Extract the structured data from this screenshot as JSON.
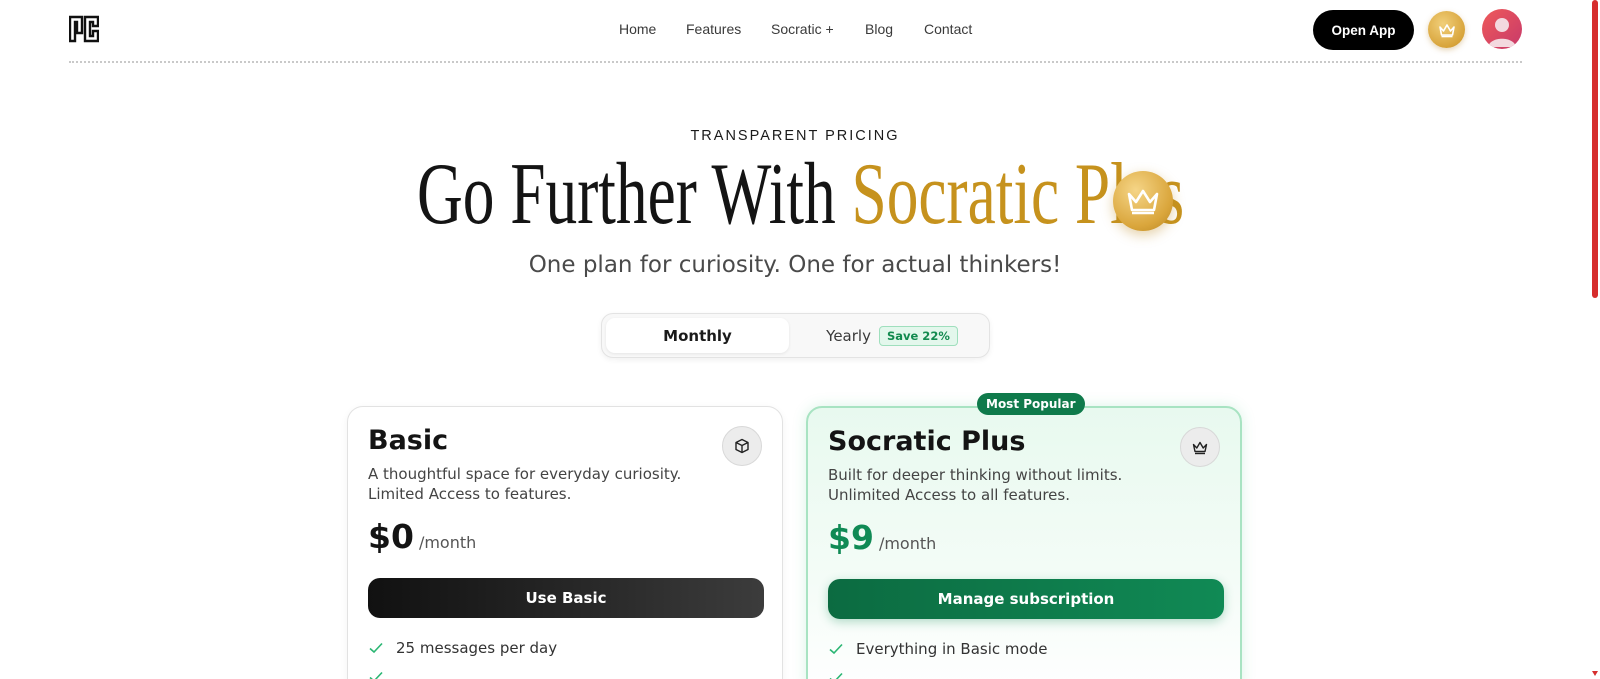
{
  "nav": {
    "links": [
      "Home",
      "Features",
      "Socratic +",
      "Blog",
      "Contact"
    ],
    "open_app": "Open App",
    "icons": [
      "logo-icon",
      "crown-icon",
      "avatar"
    ]
  },
  "hero": {
    "eyebrow": "TRANSPARENT PRICING",
    "headline_dark": "Go Further With",
    "headline_gold": "Socratic Plus",
    "subline": "One plan for curiosity. One for actual thinkers!"
  },
  "billing_toggle": {
    "monthly": "Monthly",
    "yearly": "Yearly",
    "save_badge": "Save 22%",
    "selected": "Monthly"
  },
  "plans": [
    {
      "title": "Basic",
      "description": "A thoughtful space for everyday curiosity. Limited Access to features.",
      "price": "$0",
      "unit": "/month",
      "button": "Use Basic",
      "features": [
        "25 messages per day"
      ]
    },
    {
      "title": "Socratic Plus",
      "badge": "Most Popular",
      "description": "Built for deeper thinking without limits. Unlimited Access to all features.",
      "price": "$9",
      "unit": "/month",
      "button": "Manage subscription",
      "features": [
        "Everything in Basic mode"
      ]
    }
  ],
  "colors": {
    "gold": "#c6921d",
    "green": "#108a55",
    "dark": "#141414"
  }
}
